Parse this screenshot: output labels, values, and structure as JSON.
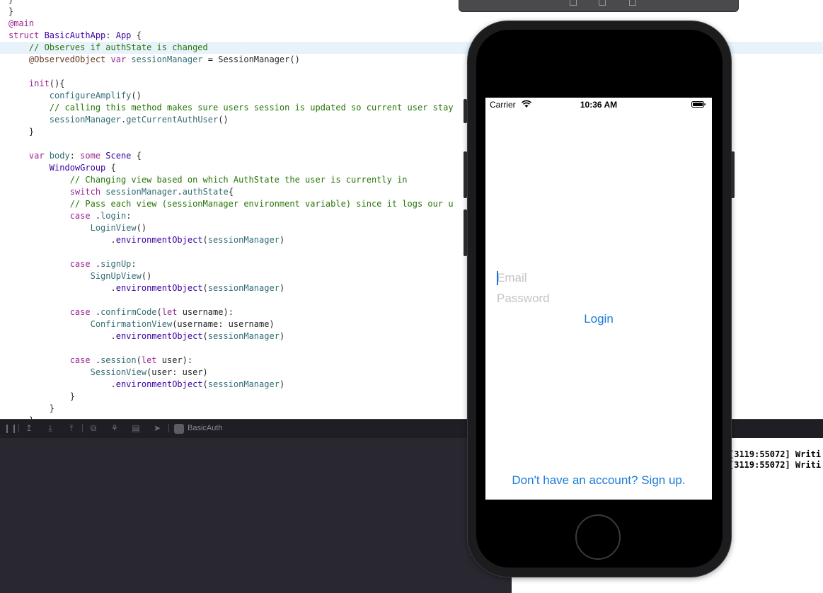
{
  "editor": {
    "lines": [
      [
        {
          "c": "pl",
          "t": "}"
        }
      ],
      [
        {
          "c": "pl",
          "t": "}"
        }
      ],
      [
        {
          "c": "kw",
          "t": "@main"
        }
      ],
      [
        {
          "c": "kw",
          "t": "struct "
        },
        {
          "c": "ty",
          "t": "BasicAuthApp"
        },
        {
          "c": "pl",
          "t": ": "
        },
        {
          "c": "ty",
          "t": "App"
        },
        {
          "c": "pl",
          "t": " {"
        }
      ],
      [
        {
          "c": "cm",
          "t": "    // Observes if authState is changed"
        }
      ],
      [
        {
          "c": "at",
          "t": "    @ObservedObject "
        },
        {
          "c": "kw",
          "t": "var "
        },
        {
          "c": "fn",
          "t": "sessionManager"
        },
        {
          "c": "pl",
          "t": " = SessionManager()"
        }
      ],
      [
        {
          "c": "pl",
          "t": ""
        }
      ],
      [
        {
          "c": "kw",
          "t": "    init"
        },
        {
          "c": "pl",
          "t": "(){"
        }
      ],
      [
        {
          "c": "pl",
          "t": "        "
        },
        {
          "c": "fn",
          "t": "configureAmplify"
        },
        {
          "c": "pl",
          "t": "()"
        }
      ],
      [
        {
          "c": "cm",
          "t": "        // calling this method makes sure users session is updated so current user stay"
        }
      ],
      [
        {
          "c": "pl",
          "t": "        "
        },
        {
          "c": "fn",
          "t": "sessionManager"
        },
        {
          "c": "pl",
          "t": "."
        },
        {
          "c": "fn",
          "t": "getCurrentAuthUser"
        },
        {
          "c": "pl",
          "t": "()"
        }
      ],
      [
        {
          "c": "pl",
          "t": "    }"
        }
      ],
      [
        {
          "c": "pl",
          "t": ""
        }
      ],
      [
        {
          "c": "kw",
          "t": "    var "
        },
        {
          "c": "fn",
          "t": "body"
        },
        {
          "c": "pl",
          "t": ": "
        },
        {
          "c": "kw",
          "t": "some "
        },
        {
          "c": "ty",
          "t": "Scene"
        },
        {
          "c": "pl",
          "t": " {"
        }
      ],
      [
        {
          "c": "pl",
          "t": "        "
        },
        {
          "c": "ty",
          "t": "WindowGroup"
        },
        {
          "c": "pl",
          "t": " {"
        }
      ],
      [
        {
          "c": "cm",
          "t": "            // Changing view based on which AuthState the user is currently in"
        }
      ],
      [
        {
          "c": "kw",
          "t": "            switch "
        },
        {
          "c": "fn",
          "t": "sessionManager"
        },
        {
          "c": "pl",
          "t": "."
        },
        {
          "c": "fn",
          "t": "authState"
        },
        {
          "c": "pl",
          "t": "{"
        }
      ],
      [
        {
          "c": "cm",
          "t": "            // Pass each view (sessionManager environment variable) since it logs our u"
        }
      ],
      [
        {
          "c": "kw",
          "t": "            case "
        },
        {
          "c": "pl",
          "t": "."
        },
        {
          "c": "fn",
          "t": "login"
        },
        {
          "c": "pl",
          "t": ":"
        }
      ],
      [
        {
          "c": "pl",
          "t": "                "
        },
        {
          "c": "fn",
          "t": "LoginView"
        },
        {
          "c": "pl",
          "t": "()"
        }
      ],
      [
        {
          "c": "pl",
          "t": "                    ."
        },
        {
          "c": "ty",
          "t": "environmentObject"
        },
        {
          "c": "pl",
          "t": "("
        },
        {
          "c": "fn",
          "t": "sessionManager"
        },
        {
          "c": "pl",
          "t": ")"
        }
      ],
      [
        {
          "c": "pl",
          "t": ""
        }
      ],
      [
        {
          "c": "kw",
          "t": "            case "
        },
        {
          "c": "pl",
          "t": "."
        },
        {
          "c": "fn",
          "t": "signUp"
        },
        {
          "c": "pl",
          "t": ":"
        }
      ],
      [
        {
          "c": "pl",
          "t": "                "
        },
        {
          "c": "fn",
          "t": "SignUpView"
        },
        {
          "c": "pl",
          "t": "()"
        }
      ],
      [
        {
          "c": "pl",
          "t": "                    ."
        },
        {
          "c": "ty",
          "t": "environmentObject"
        },
        {
          "c": "pl",
          "t": "("
        },
        {
          "c": "fn",
          "t": "sessionManager"
        },
        {
          "c": "pl",
          "t": ")"
        }
      ],
      [
        {
          "c": "pl",
          "t": ""
        }
      ],
      [
        {
          "c": "kw",
          "t": "            case "
        },
        {
          "c": "pl",
          "t": "."
        },
        {
          "c": "fn",
          "t": "confirmCode"
        },
        {
          "c": "pl",
          "t": "("
        },
        {
          "c": "kw",
          "t": "let "
        },
        {
          "c": "pl",
          "t": "username):"
        }
      ],
      [
        {
          "c": "pl",
          "t": "                "
        },
        {
          "c": "fn",
          "t": "ConfirmationView"
        },
        {
          "c": "pl",
          "t": "(username: username)"
        }
      ],
      [
        {
          "c": "pl",
          "t": "                    ."
        },
        {
          "c": "ty",
          "t": "environmentObject"
        },
        {
          "c": "pl",
          "t": "("
        },
        {
          "c": "fn",
          "t": "sessionManager"
        },
        {
          "c": "pl",
          "t": ")"
        }
      ],
      [
        {
          "c": "pl",
          "t": ""
        }
      ],
      [
        {
          "c": "kw",
          "t": "            case "
        },
        {
          "c": "pl",
          "t": "."
        },
        {
          "c": "fn",
          "t": "session"
        },
        {
          "c": "pl",
          "t": "("
        },
        {
          "c": "kw",
          "t": "let "
        },
        {
          "c": "pl",
          "t": "user):"
        }
      ],
      [
        {
          "c": "pl",
          "t": "                "
        },
        {
          "c": "fn",
          "t": "SessionView"
        },
        {
          "c": "pl",
          "t": "(user: user)"
        }
      ],
      [
        {
          "c": "pl",
          "t": "                    ."
        },
        {
          "c": "ty",
          "t": "environmentObject"
        },
        {
          "c": "pl",
          "t": "("
        },
        {
          "c": "fn",
          "t": "sessionManager"
        },
        {
          "c": "pl",
          "t": ")"
        }
      ],
      [
        {
          "c": "pl",
          "t": "            }"
        }
      ],
      [
        {
          "c": "pl",
          "t": "        }"
        }
      ],
      [
        {
          "c": "pl",
          "t": "    }"
        }
      ]
    ],
    "highlighted_line": 4
  },
  "debug_bar": {
    "scheme_name": "BasicAuth"
  },
  "console": {
    "lines": [
      "[3119:55072] Writi",
      "[3119:55072] Writi"
    ]
  },
  "simulator": {
    "status_bar": {
      "carrier": "Carrier",
      "time": "10:36 AM"
    },
    "login": {
      "email_placeholder": "Email",
      "password_placeholder": "Password",
      "login_label": "Login",
      "signup_label": "Don't have an account? Sign up."
    }
  },
  "colors": {
    "link_blue": "#1a7bd9",
    "keyword": "#9b2393",
    "comment": "#267507"
  }
}
